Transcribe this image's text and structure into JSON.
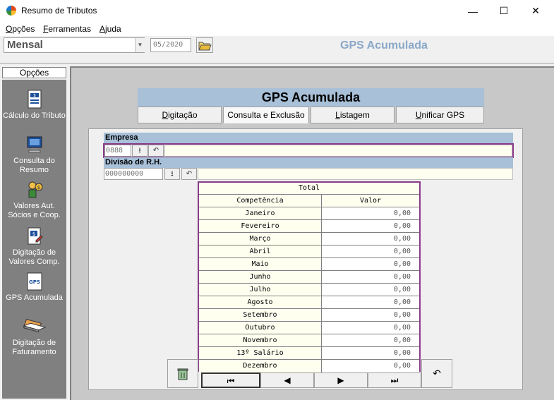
{
  "window": {
    "title": "Resumo de Tributos",
    "minimize": "—",
    "maximize": "☐",
    "close": "✕"
  },
  "menu": [
    {
      "label_u": "O",
      "label_rest": "pções"
    },
    {
      "label_u": "F",
      "label_rest": "erramentas"
    },
    {
      "label_u": "A",
      "label_rest": "juda"
    }
  ],
  "toolbar": {
    "period": "Mensal",
    "date": "05/2020",
    "title": "GPS Acumulada"
  },
  "sidebar": {
    "header": "Opções",
    "items": [
      {
        "label": "Cálculo do Tributo",
        "icon": "calculator-doc-icon"
      },
      {
        "label": "Consulta do Resumo",
        "icon": "computer-icon"
      },
      {
        "label": "Valores Aut. Sócios e Coop.",
        "icon": "money-person-icon"
      },
      {
        "label": "Digitação de Valores Comp.",
        "icon": "edit-doc-icon"
      },
      {
        "label": "GPS Acumulada",
        "icon": "gps-doc-icon"
      },
      {
        "label": "Digitação de Faturamento",
        "icon": "laptop-icon"
      }
    ]
  },
  "main": {
    "title": "GPS Acumulada",
    "tabs": [
      {
        "u": "D",
        "rest": "igitação"
      },
      {
        "u": "",
        "rest": "Consulta e Exclusão"
      },
      {
        "u": "L",
        "rest": "istagem"
      },
      {
        "u": "U",
        "rest": "nificar GPS"
      }
    ],
    "empresa": {
      "label": "Empresa",
      "code": "0888",
      "desc": ""
    },
    "divisao": {
      "label": "Divisão de R.H.",
      "code": "000000000",
      "desc": ""
    },
    "grid": {
      "total_label": "Total",
      "col_competencia": "Competência",
      "col_valor": "Valor",
      "rows": [
        {
          "month": "Janeiro",
          "value": "0,00"
        },
        {
          "month": "Fevereiro",
          "value": "0,00"
        },
        {
          "month": "Março",
          "value": "0,00"
        },
        {
          "month": "Abril",
          "value": "0,00"
        },
        {
          "month": "Maio",
          "value": "0,00"
        },
        {
          "month": "Junho",
          "value": "0,00"
        },
        {
          "month": "Julho",
          "value": "0,00"
        },
        {
          "month": "Agosto",
          "value": "0,00"
        },
        {
          "month": "Setembro",
          "value": "0,00"
        },
        {
          "month": "Outubro",
          "value": "0,00"
        },
        {
          "month": "Novembro",
          "value": "0,00"
        },
        {
          "month": "13º Salário",
          "value": "0,00"
        },
        {
          "month": "Dezembro",
          "value": "0,00"
        }
      ]
    },
    "nav": {
      "first": "⏮",
      "prev": "◀",
      "next": "▶",
      "last": "⏭",
      "undo": "↶"
    }
  }
}
